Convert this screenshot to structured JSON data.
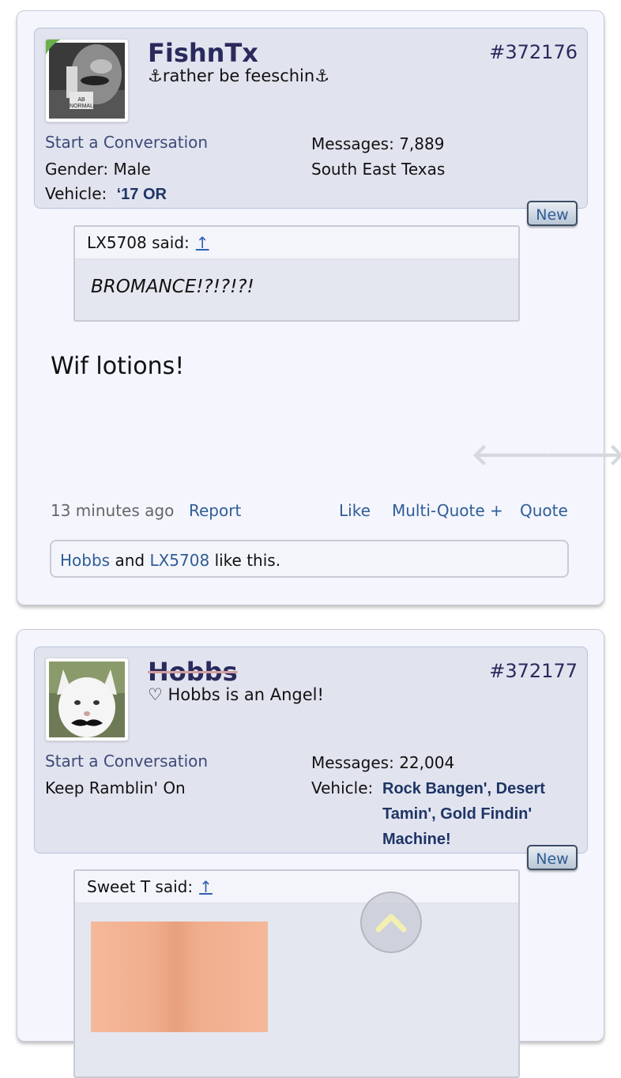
{
  "posts": [
    {
      "username": "FishnTx",
      "user_title": "⚓rather be feeschin⚓",
      "post_number": "#372176",
      "start_conversation": "Start a Conversation",
      "gender_label": "Gender:",
      "gender_value": "Male",
      "vehicle_label": "Vehicle:",
      "vehicle_value": "‘17 OR",
      "messages_label": "Messages:",
      "messages_value": "7,889",
      "location": "South East Texas",
      "new_badge": "New",
      "quote": {
        "author_said": "LX5708 said:",
        "up_arrow": "↑",
        "text": "BROMANCE!?!?!?!"
      },
      "body": "Wif lotions!",
      "time_ago": "13 minutes ago",
      "report": "Report",
      "like": "Like",
      "multi_quote": "Multi-Quote +",
      "quote_action": "Quote",
      "likes": {
        "user1": "Hobbs",
        "and": "and",
        "user2": "LX5708",
        "suffix": "like this."
      },
      "prev_icon": "arrow-left-icon",
      "next_icon": "arrow-right-icon"
    },
    {
      "username": "Hobbs",
      "user_title": "♡ Hobbs is an Angel!",
      "post_number": "#372177",
      "start_conversation": "Start a Conversation",
      "tagline": "Keep Ramblin' On",
      "messages_label": "Messages:",
      "messages_value": "22,004",
      "vehicle_label": "Vehicle:",
      "vehicle_line1": "Rock Bangen', Desert",
      "vehicle_line2": "Tamin', Gold Findin'",
      "vehicle_line3": "Machine!",
      "new_badge": "New",
      "quote": {
        "author_said": "Sweet T said:",
        "up_arrow": "↑"
      }
    }
  ],
  "colors": {
    "accent_link": "#2f5d96",
    "username": "#2a2a5c",
    "vehicle_link": "#1e3465"
  },
  "scroll_top_icon": "chevron-up-icon"
}
